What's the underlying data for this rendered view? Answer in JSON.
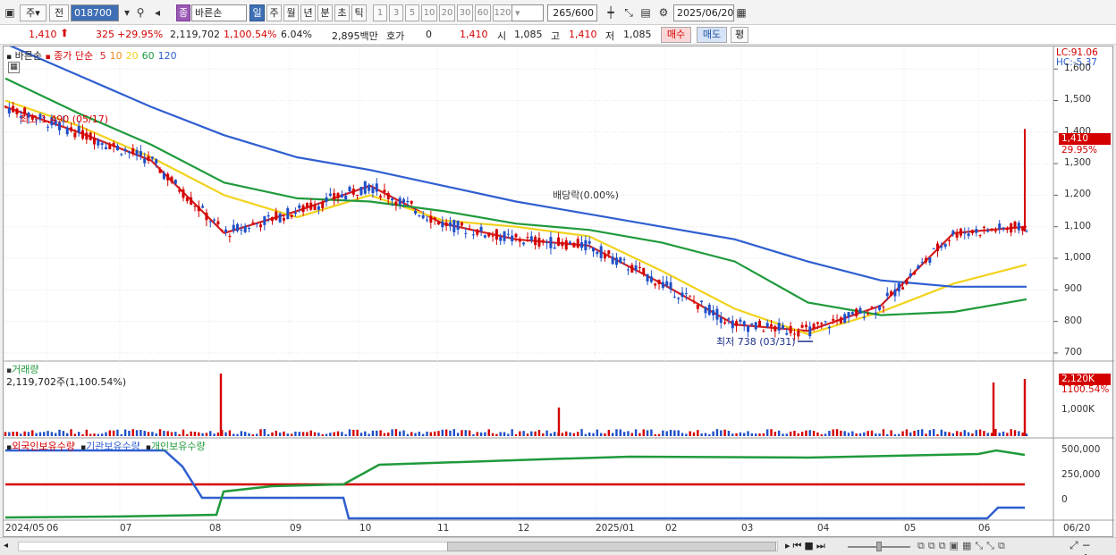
{
  "toolbar": {
    "market": "주",
    "scope": "전",
    "code": "018700",
    "stock_name": "바른손",
    "badge": "종",
    "periods": [
      "일",
      "주",
      "월",
      "년",
      "분",
      "초",
      "틱"
    ],
    "active_period": "일",
    "intervals": [
      "1",
      "3",
      "5",
      "10",
      "20",
      "30",
      "60",
      "120"
    ],
    "count": "265",
    "count_max": "/600",
    "date": "2025/06/20"
  },
  "quote": {
    "price": "1,410",
    "change": "325",
    "change_pct": "+29.95%",
    "volume": "2,119,702",
    "volume_pct": "1,100.54%",
    "turnover": "6.04%",
    "amount": "2,895백만",
    "hoga_label": "호가",
    "hoga_value": "0",
    "hoga_price": "1,410",
    "open_label": "시",
    "open": "1,085",
    "high_label": "고",
    "high": "1,410",
    "low_label": "저",
    "low": "1,085",
    "buy": "매수",
    "sell": "매도",
    "eval": "평"
  },
  "legend": {
    "name": "바른손",
    "ma_label": "종가 단순",
    "ma": [
      {
        "label": "5",
        "color": "#d62020"
      },
      {
        "label": "10",
        "color": "#f28c1c"
      },
      {
        "label": "20",
        "color": "#f2d21c"
      },
      {
        "label": "60",
        "color": "#1f9a3c"
      },
      {
        "label": "120",
        "color": "#2f5fd0"
      }
    ],
    "lc": "LC:91.06",
    "hc": "HC:-5.37"
  },
  "annotations": {
    "high": "최고 1,490 (05/17)",
    "low": "최저 738 (03/31)",
    "dividend": "배당락(0.00%)",
    "last_price": "1,410",
    "last_pct": "29.95%"
  },
  "volume_panel": {
    "title": "거래량",
    "value": "2,119,702주(1,100.54%)",
    "last_tag": "2,120K",
    "last_pct": "1100.54%",
    "axis": "1,000K"
  },
  "holdings_panel": {
    "series": [
      {
        "name": "외국인보유수량",
        "color": "#d40000"
      },
      {
        "name": "기관보유수량",
        "color": "#2f5fd0"
      },
      {
        "name": "개인보유수량",
        "color": "#1f9a3c"
      }
    ],
    "axis": [
      "500,000",
      "250,000",
      "0"
    ]
  },
  "price_axis": [
    "1,600",
    "1,500",
    "1,400",
    "1,300",
    "1,200",
    "1,100",
    "1,000",
    "900",
    "800",
    "700"
  ],
  "x_axis": [
    "2024/05",
    "06",
    "07",
    "08",
    "09",
    "10",
    "11",
    "12",
    "2025/01",
    "02",
    "03",
    "04",
    "05",
    "06",
    "06/20"
  ],
  "chart_data": {
    "type": "line",
    "x": [
      "2024/05",
      "06",
      "07",
      "08",
      "09",
      "10",
      "11",
      "12",
      "2025/01",
      "02",
      "03",
      "04",
      "05",
      "06",
      "06/20"
    ],
    "series": [
      {
        "name": "5",
        "values": [
          1480,
          1400,
          1310,
          1080,
          1150,
          1230,
          1110,
          1060,
          1040,
          920,
          790,
          770,
          850,
          1080,
          1100
        ]
      },
      {
        "name": "20",
        "values": [
          1500,
          1420,
          1320,
          1200,
          1130,
          1200,
          1120,
          1100,
          1070,
          960,
          840,
          760,
          830,
          920,
          980
        ]
      },
      {
        "name": "60",
        "values": [
          1570,
          1460,
          1360,
          1240,
          1190,
          1180,
          1150,
          1110,
          1090,
          1050,
          990,
          860,
          820,
          830,
          870
        ]
      },
      {
        "name": "120",
        "values": [
          1680,
          1580,
          1480,
          1390,
          1320,
          1280,
          1230,
          1180,
          1140,
          1100,
          1060,
          990,
          930,
          910,
          910
        ]
      }
    ],
    "ylim": [
      680,
      1660
    ]
  }
}
